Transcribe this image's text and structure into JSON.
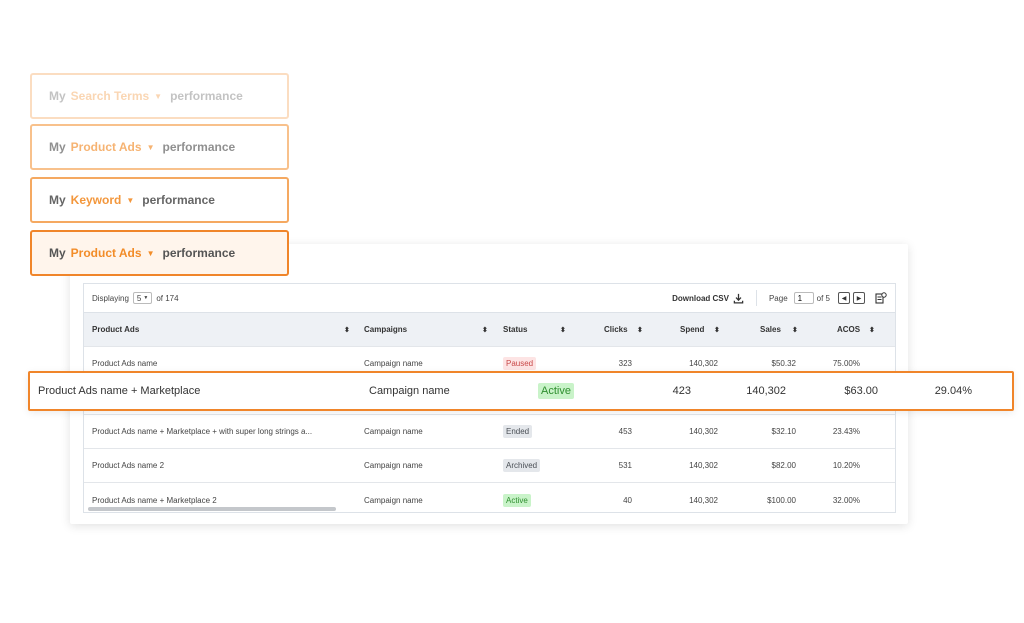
{
  "selectors": [
    {
      "prefix": "My",
      "option": "Search Terms",
      "suffix": "performance"
    },
    {
      "prefix": "My",
      "option": "Product Ads",
      "suffix": "performance"
    },
    {
      "prefix": "My",
      "option": "Keyword",
      "suffix": "performance"
    },
    {
      "prefix": "My",
      "option": "Product Ads",
      "suffix": "performance"
    }
  ],
  "toolbar": {
    "displaying_label": "Displaying",
    "page_size": "5",
    "total_label": "of 174",
    "download_label": "Download CSV",
    "page_label": "Page",
    "page_value": "1",
    "page_total": "of 5"
  },
  "columns": {
    "ads": "Product Ads",
    "campaigns": "Campaigns",
    "status": "Status",
    "clicks": "Clicks",
    "spend": "Spend",
    "sales": "Sales",
    "acos": "ACOS"
  },
  "rows": [
    {
      "ads": "Product Ads name",
      "campaign": "Campaign name",
      "status": "Paused",
      "clicks": "323",
      "spend": "140,302",
      "sales": "$50.32",
      "acos": "75.00%"
    },
    {
      "ads": "Product Ads name + Marketplace + with super long strings a...",
      "campaign": "Campaign name",
      "status": "Ended",
      "clicks": "453",
      "spend": "140,302",
      "sales": "$32.10",
      "acos": "23.43%"
    },
    {
      "ads": "Product Ads name 2",
      "campaign": "Campaign name",
      "status": "Archived",
      "clicks": "531",
      "spend": "140,302",
      "sales": "$82.00",
      "acos": "10.20%"
    },
    {
      "ads": "Product Ads name + Marketplace 2",
      "campaign": "Campaign name",
      "status": "Active",
      "clicks": "40",
      "spend": "140,302",
      "sales": "$100.00",
      "acos": "32.00%"
    }
  ],
  "highlighted_row": {
    "ads": "Product Ads name + Marketplace",
    "campaign": "Campaign name",
    "status": "Active",
    "clicks": "423",
    "spend": "140,302",
    "sales": "$63.00",
    "acos": "29.04%"
  },
  "status_colors": {
    "Paused": {
      "bg": "#fde4e4",
      "fg": "#c84848"
    },
    "Ended": {
      "bg": "#e4e7eb",
      "fg": "#4a4f55"
    },
    "Archived": {
      "bg": "#e4e7eb",
      "fg": "#4a4f55"
    },
    "Active": {
      "bg": "#c9f3c9",
      "fg": "#2f8f2f"
    }
  },
  "accent_color": "#f28c28"
}
